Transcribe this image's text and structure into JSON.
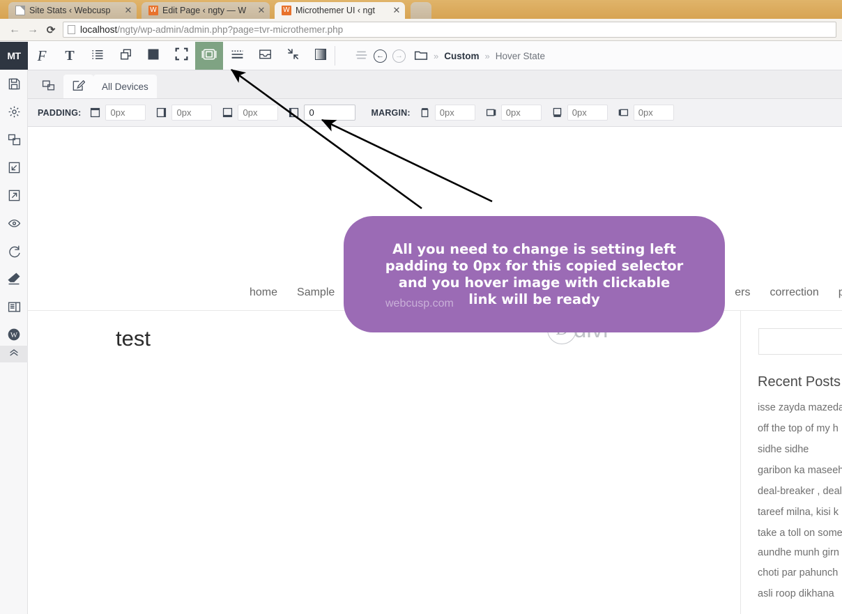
{
  "browser": {
    "tabs": [
      {
        "title": "Site Stats ‹ Webcusp",
        "favicon": "document-icon",
        "active": false
      },
      {
        "title": "Edit Page ‹ ngty — W",
        "favicon": "wordpress-icon",
        "active": false
      },
      {
        "title": "Microthemer UI ‹ ngt",
        "favicon": "wordpress-icon",
        "active": true
      }
    ],
    "close_glyph": "✕",
    "back_glyph": "←",
    "forward_glyph": "→",
    "reload_glyph": "⟳",
    "url_host": "localhost",
    "url_path": "/ngty/wp-admin/admin.php?page=tvr-microthemer.php"
  },
  "microthemer": {
    "logo_text": "MT",
    "rail_items": [
      {
        "name": "save-icon",
        "label": "Save"
      },
      {
        "name": "gear-icon",
        "label": "Settings"
      },
      {
        "name": "devices-icon",
        "label": "Devices"
      },
      {
        "name": "import-icon",
        "label": "Import"
      },
      {
        "name": "export-icon",
        "label": "Export"
      },
      {
        "name": "eye-icon",
        "label": "Preview"
      },
      {
        "name": "refresh-icon",
        "label": "Refresh"
      },
      {
        "name": "eraser-icon",
        "label": "Clear styles"
      },
      {
        "name": "layout-icon",
        "label": "Layout"
      },
      {
        "name": "wordpress-icon",
        "label": "WordPress"
      }
    ],
    "rail_collapse_glyph": "⌃⌃",
    "toolbar_buttons": [
      {
        "name": "font-icon",
        "label": "Fonts",
        "active": false
      },
      {
        "name": "text-icon",
        "label": "Text",
        "active": false
      },
      {
        "name": "list-icon",
        "label": "Lists",
        "active": false
      },
      {
        "name": "layers-icon",
        "label": "Background",
        "active": false
      },
      {
        "name": "solid-square-icon",
        "label": "Color",
        "active": false
      },
      {
        "name": "fullscreen-icon",
        "label": "Dimensions",
        "active": false
      },
      {
        "name": "spacing-icon",
        "label": "Padding & Margin",
        "active": true
      },
      {
        "name": "border-icon",
        "label": "Borders",
        "active": false
      },
      {
        "name": "inbox-icon",
        "label": "Box shadow",
        "active": false
      },
      {
        "name": "collapse-arrows-icon",
        "label": "Transform",
        "active": false
      },
      {
        "name": "gradient-icon",
        "label": "Gradient",
        "active": false
      },
      {
        "name": "menu-lines-icon",
        "label": "Menu",
        "active": false
      }
    ],
    "breadcrumb": {
      "back_glyph": "←",
      "forward_glyph": "→",
      "folder_icon": "folder-icon",
      "sep": "»",
      "folder_label": "Custom",
      "state_label": "Hover State"
    },
    "tabs": {
      "responsive_icon": "responsive-icon",
      "edit_icon": "edit-selector-icon",
      "device_label": "All Devices"
    },
    "padding": {
      "label": "PADDING:",
      "fields": [
        {
          "name": "padding-top-input",
          "icon": "box-top-icon",
          "value": "",
          "placeholder": "0px"
        },
        {
          "name": "padding-right-input",
          "icon": "box-right-icon",
          "value": "",
          "placeholder": "0px"
        },
        {
          "name": "padding-bottom-input",
          "icon": "box-bottom-icon",
          "value": "",
          "placeholder": "0px"
        },
        {
          "name": "padding-left-input",
          "icon": "box-left-icon",
          "value": "0",
          "placeholder": "0px"
        }
      ]
    },
    "margin": {
      "label": "MARGIN:",
      "fields": [
        {
          "name": "margin-top-input",
          "icon": "box-top-icon",
          "value": "",
          "placeholder": "0px"
        },
        {
          "name": "margin-right-input",
          "icon": "box-right-icon",
          "value": "",
          "placeholder": "0px"
        },
        {
          "name": "margin-bottom-input",
          "icon": "box-bottom-icon",
          "value": "",
          "placeholder": "0px"
        },
        {
          "name": "margin-left-input",
          "icon": "box-left-icon",
          "value": "",
          "placeholder": "0px"
        }
      ]
    }
  },
  "preview": {
    "site_logo_mark": "D",
    "site_logo_text": "divi",
    "nav_items": [
      "home",
      "Sample",
      "ers",
      "correction",
      "p"
    ],
    "page_title": "test",
    "sidebar": {
      "search_value": "",
      "heading": "Recent Posts",
      "posts": [
        "isse zayda mazeda",
        "off the top of my h",
        "sidhe sidhe",
        "garibon ka maseeh",
        "deal-breaker , deal",
        "tareef milna, kisi k",
        "take a toll on some",
        "aundhe munh girn hona",
        "choti par pahunch",
        "asli roop dikhana"
      ]
    }
  },
  "annotation": {
    "callout_text": "All you need to change is setting left\npadding to 0px for this copied selector\nand you hover image with clickable\nlink will be ready",
    "watermark": "webcusp.com",
    "callout_color": "#9b6bb5",
    "arrow_color": "#000000"
  }
}
